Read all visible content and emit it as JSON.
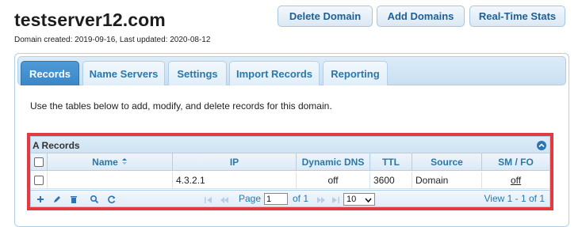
{
  "header": {
    "domain": "testserver12.com",
    "meta": "Domain created: 2019-09-16, Last updated: 2020-08-12",
    "buttons": {
      "delete": "Delete Domain",
      "add": "Add Domains",
      "stats": "Real-Time Stats"
    }
  },
  "tabs": [
    {
      "label": "Records",
      "active": true
    },
    {
      "label": "Name Servers"
    },
    {
      "label": "Settings"
    },
    {
      "label": "Import Records"
    },
    {
      "label": "Reporting"
    }
  ],
  "intro": "Use the tables below to add, modify, and delete records for this domain.",
  "grid": {
    "caption": "A Records",
    "columns": [
      "Name",
      "IP",
      "Dynamic DNS",
      "TTL",
      "Source",
      "SM / FO"
    ],
    "sorted_column": "Name",
    "rows": [
      {
        "name": "",
        "ip": "4.3.2.1",
        "dynamic": "off",
        "ttl": "3600",
        "source": "Domain",
        "smfo": "off"
      }
    ],
    "pager": {
      "page_label": "Page",
      "page_value": "1",
      "of_label": "of 1",
      "rows_per_page": "10",
      "view": "View 1 - 1 of 1"
    }
  },
  "colors": {
    "accent": "#2779aa",
    "active_tab": "#3b87c6",
    "highlight": "#e23a3f"
  },
  "icons": [
    "add-icon",
    "edit-icon",
    "delete-icon",
    "search-icon",
    "refresh-icon",
    "collapse-icon",
    "sort-icon",
    "first-page-icon",
    "prev-page-icon",
    "next-page-icon",
    "last-page-icon"
  ]
}
